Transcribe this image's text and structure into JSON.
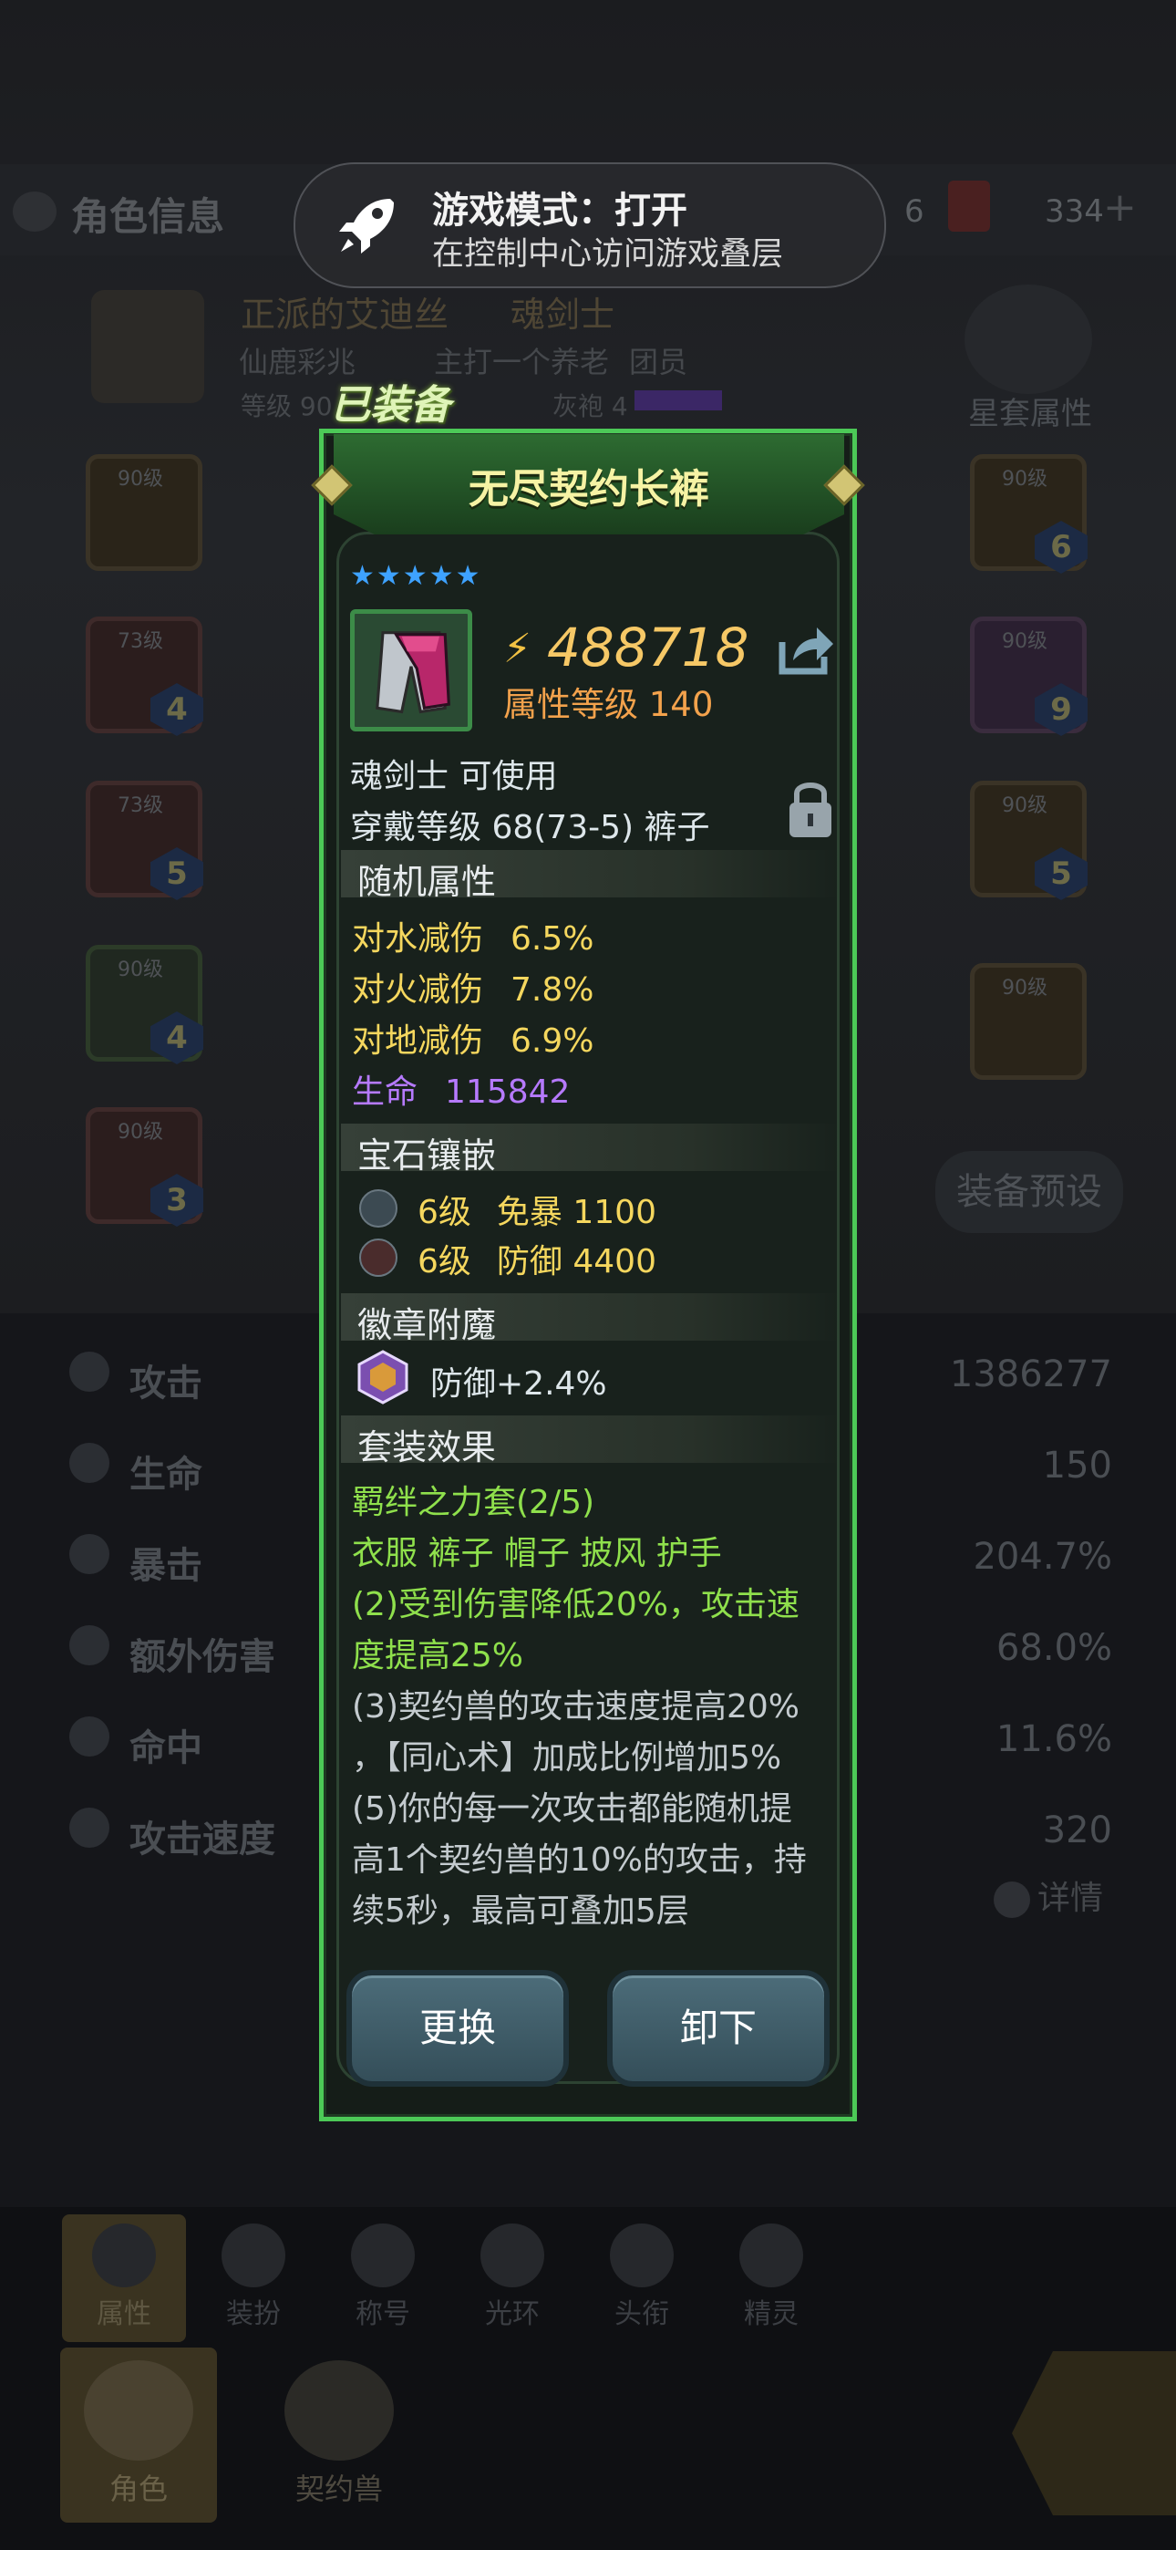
{
  "background": {
    "header_title": "角色信息",
    "currency_left": "6",
    "currency_right": "334",
    "char_name": "正派的艾迪丝",
    "char_class": "魂剑士",
    "guild": "仙鹿彩兆",
    "guild_motto": "主打一个养老",
    "guild_role": "团员",
    "level_label": "等级 90",
    "rank_label": "灰袍 4",
    "set_attr_button": "星套属性",
    "preset_button": "装备预设",
    "details_link": "详情",
    "left_slots": [
      {
        "level": "90级",
        "gem": ""
      },
      {
        "level": "73级",
        "gem": "4"
      },
      {
        "level": "73级",
        "gem": "5"
      },
      {
        "level": "90级",
        "gem": "4"
      },
      {
        "level": "90级",
        "gem": "3"
      }
    ],
    "right_slots": [
      {
        "level": "90级",
        "gem": "6"
      },
      {
        "level": "90级",
        "gem": "9"
      },
      {
        "level": "90级",
        "gem": "5"
      },
      {
        "level": "90级",
        "gem": ""
      }
    ],
    "stats": [
      {
        "name": "攻击",
        "value": "1386277"
      },
      {
        "name": "生命",
        "value": "150"
      },
      {
        "name": "暴击",
        "value": "204.7%"
      },
      {
        "name": "额外伤害",
        "value": "68.0%"
      },
      {
        "name": "命中",
        "value": "11.6%"
      },
      {
        "name": "攻击速度",
        "value": "320"
      }
    ],
    "tabs": [
      "属性",
      "装扮",
      "称号",
      "光环",
      "头衔",
      "精灵"
    ],
    "bottom_nav": [
      "角色",
      "契约兽"
    ]
  },
  "notification": {
    "title": "游戏模式：打开",
    "subtitle": "在控制中心访问游戏叠层"
  },
  "item": {
    "equipped_tag": "已装备",
    "name": "无尽契约长裤",
    "stars": "★★★★★",
    "power": "488718",
    "attr_level": "属性等级 140",
    "usable_by": "魂剑士 可使用",
    "wear_info": "穿戴等级 68(73-5) 裤子",
    "random_attr_title": "随机属性",
    "random_attrs": [
      {
        "name": "对水减伤",
        "value": "6.5%"
      },
      {
        "name": "对火减伤",
        "value": "7.8%"
      },
      {
        "name": "对地减伤",
        "value": "6.9%"
      }
    ],
    "life_attr": {
      "name": "生命",
      "value": "115842"
    },
    "gem_title": "宝石镶嵌",
    "gems": [
      {
        "level": "6级",
        "effect": "免暴 1100"
      },
      {
        "level": "6级",
        "effect": "防御 4400"
      }
    ],
    "badge_title": "徽章附魔",
    "badge_effect": "防御+2.4%",
    "set_title": "套装效果",
    "set_name": "羁绊之力套(2/5)",
    "set_pieces": "衣服 裤子 帽子 披风 护手",
    "set_effects": [
      "(2)受到伤害降低20%，攻击速",
      "度提高25%",
      "(3)契约兽的攻击速度提高20%",
      "，【同心术】加成比例增加5%",
      "(5)你的每一次攻击都能随机提",
      "高1个契约兽的10%的攻击，持",
      "续5秒，最高可叠加5层"
    ],
    "replace_button": "更换",
    "unequip_button": "卸下"
  },
  "colors": {
    "frame_green": "#4cc957",
    "power_gold": "#f6c866",
    "attr_yellow": "#f5d75e",
    "life_purple": "#b67aff",
    "set_green": "#8fe04c"
  }
}
